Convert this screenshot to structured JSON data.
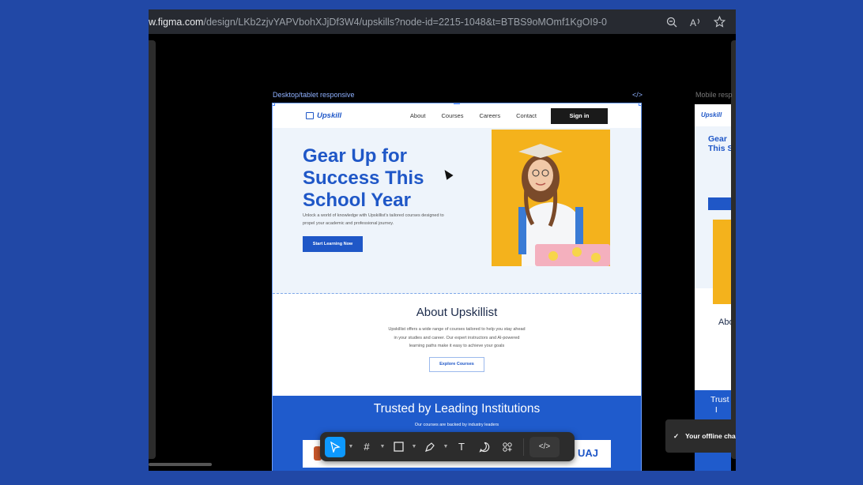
{
  "browser": {
    "url_host": "w.figma.com",
    "url_path": "/design/LKb2zjvYAPVbohXJjDf3W4/upskills?node-id=2215-1048&t=BTBS9oMOmf1KgOI9-0",
    "icons": [
      "zoom-out-icon",
      "read-aloud-icon",
      "favorite-star-icon"
    ]
  },
  "canvas": {
    "desktop_label": "Desktop/tablet responsive",
    "code_tag": "</>",
    "mobile_label": "Mobile resp"
  },
  "site": {
    "logo": "Upskill",
    "nav": [
      "About",
      "Courses",
      "Careers",
      "Contact"
    ],
    "signin": "Sign in",
    "hero_title": "Gear Up for Success This School Year",
    "hero_sub": "Unlock a world of knowledge with Upskillist's tailored courses designed to propel your academic and professional journey.",
    "hero_btn": "Start Learning Now",
    "about_title": "About Upskillist",
    "about_text": "Upskillist offers a wide range of courses tailored to help you stay ahead in your studies and career. Our expert instructors and AI-powered learning paths make it easy to achieve your goals",
    "about_btn": "Explore Courses",
    "trusted_title": "Trusted by Leading Institutions",
    "trusted_sub": "Our courses are backed by industry leaders",
    "partner_logo": "UAJ"
  },
  "mobile": {
    "logo": "Upskill",
    "hero_title": "Gear\nThis S",
    "about": "Abo",
    "trusted": "Trust\n I"
  },
  "toast": {
    "text": "Your offline cha"
  },
  "toolbar": {
    "tools": [
      "move-tool",
      "frame-tool",
      "shape-tool",
      "pen-tool",
      "text-tool",
      "comment-tool",
      "actions-tool",
      "dev-mode-toggle"
    ]
  }
}
